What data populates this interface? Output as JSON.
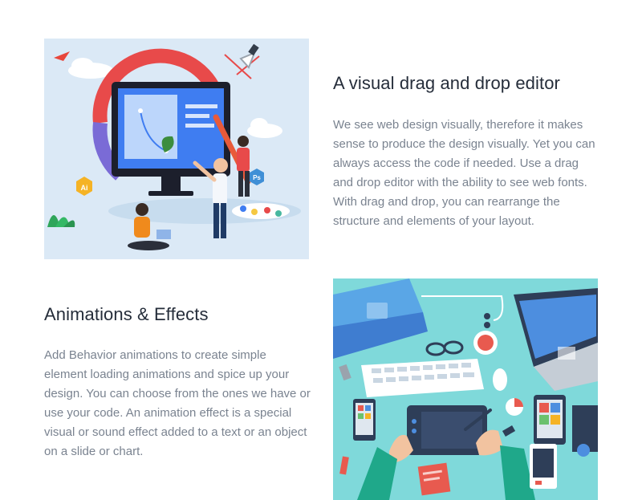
{
  "features": [
    {
      "title": "A visual drag and drop editor",
      "description": "We see web design visually, therefore it makes sense to produce the design visually. Yet you can always access the code if needed. Use a drag and drop editor with the ability to see web fonts. With drag and drop, you can rearrange the structure and elements of your layout."
    },
    {
      "title": "Animations & Effects",
      "description": "Add Behavior animations to create simple element loading animations and spice up your design. You can choose from the ones we have or use your code. An animation effect is a special visual or sound effect added to a text or an object on a slide or chart."
    }
  ],
  "illustrations": {
    "editor_badge_ai": "Ai",
    "editor_badge_ps": "Ps"
  },
  "colors": {
    "title": "#252d3a",
    "body_text": "#7a8390",
    "illustration1_bg": "#dbe9f6",
    "illustration2_bg": "#7fd9da"
  }
}
